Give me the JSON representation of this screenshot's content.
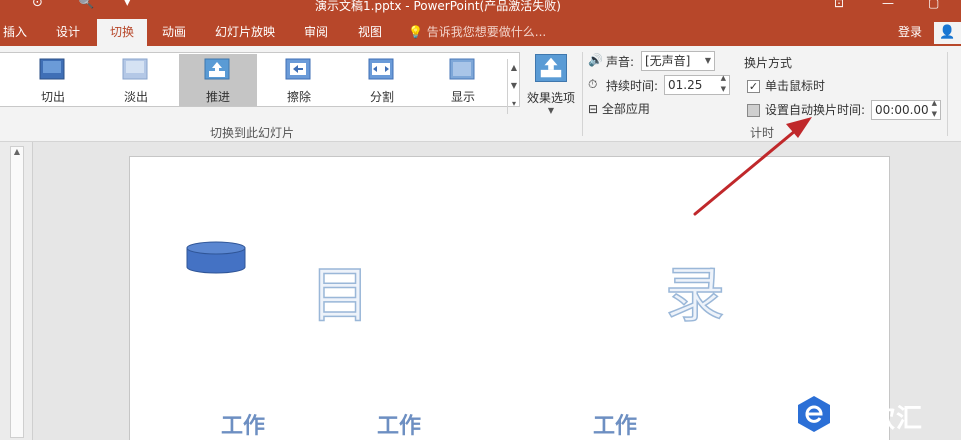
{
  "titlebar": {
    "title": "演示文稿1.pptx - PowerPoint(产品激活失败)",
    "qat_icons": [
      "touch-mode-icon",
      "print-preview-icon",
      "customize-qat-icon"
    ],
    "window_icons": [
      "ribbon-display-icon",
      "minimize-icon",
      "restore-icon"
    ]
  },
  "tabs": [
    {
      "label": "插入",
      "active": false
    },
    {
      "label": "设计",
      "active": false
    },
    {
      "label": "切换",
      "active": true
    },
    {
      "label": "动画",
      "active": false
    },
    {
      "label": "幻灯片放映",
      "active": false
    },
    {
      "label": "审阅",
      "active": false
    },
    {
      "label": "视图",
      "active": false
    }
  ],
  "tellme": "告诉我您想要做什么...",
  "login": "登录",
  "ribbon": {
    "transitions": [
      {
        "label": "切出",
        "selected": false
      },
      {
        "label": "淡出",
        "selected": false
      },
      {
        "label": "推进",
        "selected": true
      },
      {
        "label": "擦除",
        "selected": false
      },
      {
        "label": "分割",
        "selected": false
      },
      {
        "label": "显示",
        "selected": false
      }
    ],
    "effect_options": "效果选项",
    "group_transitions_label": "切换到此幻灯片",
    "sound_label": "声音:",
    "sound_value": "[无声音]",
    "duration_label": "持续时间:",
    "duration_value": "01.25",
    "apply_all": "全部应用",
    "advance_title": "换片方式",
    "on_click": "单击鼠标时",
    "on_click_checked": true,
    "after_time": "设置自动换片时间:",
    "after_time_checked": false,
    "after_time_value": "00:00.00",
    "group_timing_label": "计时"
  },
  "slide": {
    "title_left": "目",
    "title_right": "录",
    "items": [
      "工作",
      "工作",
      "工作"
    ]
  },
  "watermark": {
    "text": "易软汇"
  },
  "colors": {
    "accent": "#b7472a",
    "arrow": "#c0282b",
    "shape_fill": "#4472c4"
  }
}
